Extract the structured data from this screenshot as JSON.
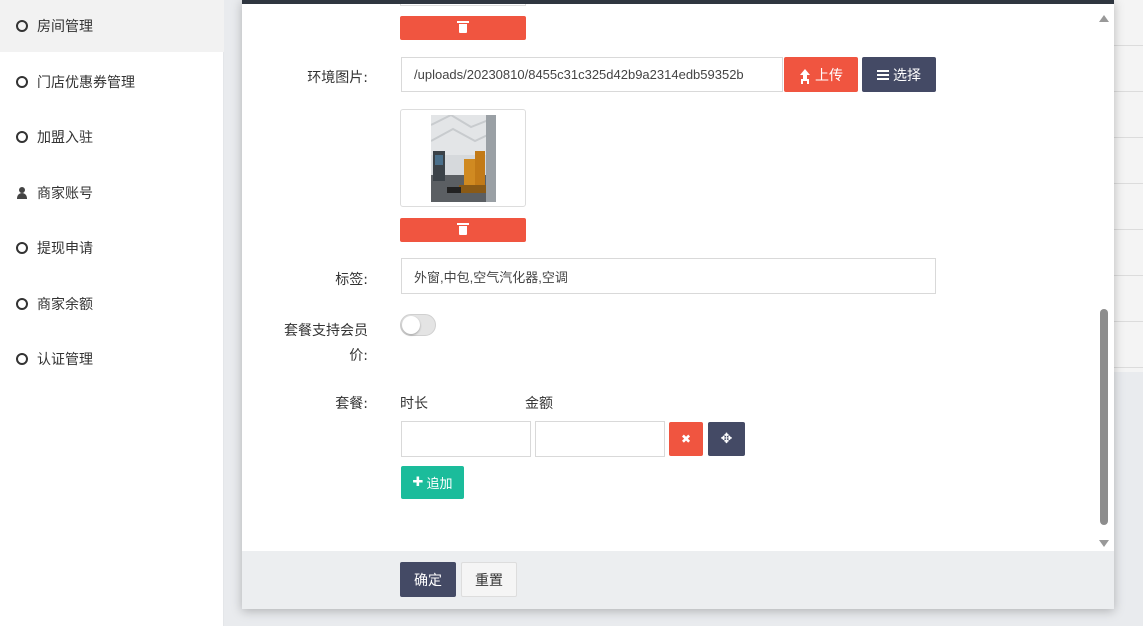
{
  "sidebar": {
    "items": [
      {
        "label": "房间管理",
        "icon": "circle-icon",
        "active": true
      },
      {
        "label": "门店优惠券管理",
        "icon": "circle-icon"
      },
      {
        "label": "加盟入驻",
        "icon": "circle-icon"
      },
      {
        "label": "商家账号",
        "icon": "user-icon"
      },
      {
        "label": "提现申请",
        "icon": "circle-icon"
      },
      {
        "label": "商家余额",
        "icon": "circle-icon"
      },
      {
        "label": "认证管理",
        "icon": "circle-icon"
      }
    ]
  },
  "form": {
    "env_image": {
      "label": "环境图片:",
      "value": "/uploads/20230810/8455c31c325d42b9a2314edb59352b",
      "upload_label": "上传",
      "select_label": "选择"
    },
    "tags": {
      "label": "标签:",
      "value": "外窗,中包,空气汽化器,空调"
    },
    "member_price": {
      "label_line1": "套餐支持会员",
      "label_line2": "价:",
      "enabled": false
    },
    "packages": {
      "label": "套餐:",
      "col_duration": "时长",
      "col_amount": "金额",
      "duration_value": "",
      "amount_value": "",
      "add_label": "追加"
    }
  },
  "footer": {
    "confirm_label": "确定",
    "reset_label": "重置"
  },
  "colors": {
    "accent_red": "#f05540",
    "accent_dark": "#444a65",
    "accent_green": "#1bbc9b"
  }
}
